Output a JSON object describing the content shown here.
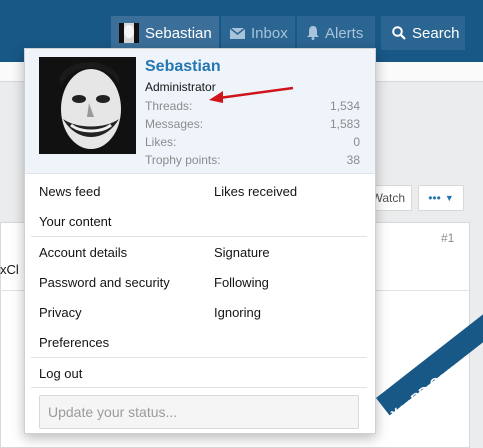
{
  "nav": {
    "user_label": "Sebastian",
    "inbox_label": "Inbox",
    "alerts_label": "Alerts",
    "search_label": "Search"
  },
  "background": {
    "watch_label": "Watch",
    "more_label": "•••",
    "post_number": "#1",
    "partial_text": "xCl"
  },
  "menu": {
    "username": "Sebastian",
    "user_title": "Administrator",
    "stats": [
      {
        "label": "Threads:",
        "value": "1,534"
      },
      {
        "label": "Messages:",
        "value": "1,583"
      },
      {
        "label": "Likes:",
        "value": "0"
      },
      {
        "label": "Trophy points:",
        "value": "38"
      }
    ],
    "links": {
      "news_feed": "News feed",
      "likes_received": "Likes received",
      "your_content": "Your content",
      "account_details": "Account details",
      "signature": "Signature",
      "password_security": "Password and security",
      "following": "Following",
      "privacy": "Privacy",
      "ignoring": "Ignoring",
      "preferences": "Preferences",
      "log_out": "Log out"
    },
    "status_placeholder": "Update your status..."
  },
  "watermark": "XenBD.Com",
  "colors": {
    "nav_bg": "#185886",
    "tab_active": "#3b6f99",
    "link_blue": "#2577b1",
    "annotation_arrow": "#d0141c"
  }
}
